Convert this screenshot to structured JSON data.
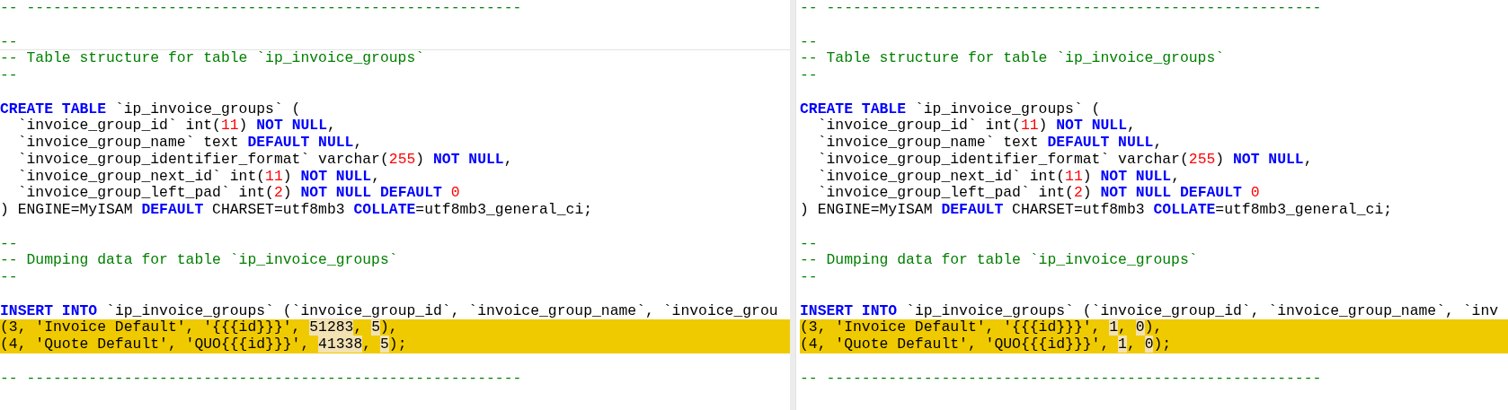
{
  "panes": [
    {
      "lines": [
        {
          "kind": "code",
          "changed": false,
          "tokens": [
            {
              "kind": "comment",
              "text": "-- --------------------------------------------------------"
            }
          ]
        },
        {
          "kind": "blank"
        },
        {
          "kind": "code",
          "changed": false,
          "rule_below": true,
          "tokens": [
            {
              "kind": "comment",
              "text": "--"
            }
          ]
        },
        {
          "kind": "code",
          "changed": false,
          "tokens": [
            {
              "kind": "comment",
              "text": "-- Table structure for table `ip_invoice_groups`"
            }
          ]
        },
        {
          "kind": "code",
          "changed": false,
          "tokens": [
            {
              "kind": "comment",
              "text": "--"
            }
          ]
        },
        {
          "kind": "blank"
        },
        {
          "kind": "code",
          "changed": false,
          "tokens": [
            {
              "kind": "keyword",
              "text": "CREATE TABLE"
            },
            {
              "kind": "plain",
              "text": " `ip_invoice_groups` ("
            }
          ]
        },
        {
          "kind": "code",
          "changed": false,
          "tokens": [
            {
              "kind": "plain",
              "text": "  `invoice_group_id` int("
            },
            {
              "kind": "number",
              "text": "11"
            },
            {
              "kind": "plain",
              "text": ") "
            },
            {
              "kind": "keyword",
              "text": "NOT NULL"
            },
            {
              "kind": "plain",
              "text": ","
            }
          ]
        },
        {
          "kind": "code",
          "changed": false,
          "tokens": [
            {
              "kind": "plain",
              "text": "  `invoice_group_name` text "
            },
            {
              "kind": "keyword",
              "text": "DEFAULT NULL"
            },
            {
              "kind": "plain",
              "text": ","
            }
          ]
        },
        {
          "kind": "code",
          "changed": false,
          "tokens": [
            {
              "kind": "plain",
              "text": "  `invoice_group_identifier_format` varchar("
            },
            {
              "kind": "number",
              "text": "255"
            },
            {
              "kind": "plain",
              "text": ") "
            },
            {
              "kind": "keyword",
              "text": "NOT NULL"
            },
            {
              "kind": "plain",
              "text": ","
            }
          ]
        },
        {
          "kind": "code",
          "changed": false,
          "tokens": [
            {
              "kind": "plain",
              "text": "  `invoice_group_next_id` int("
            },
            {
              "kind": "number",
              "text": "11"
            },
            {
              "kind": "plain",
              "text": ") "
            },
            {
              "kind": "keyword",
              "text": "NOT NULL"
            },
            {
              "kind": "plain",
              "text": ","
            }
          ]
        },
        {
          "kind": "code",
          "changed": false,
          "tokens": [
            {
              "kind": "plain",
              "text": "  `invoice_group_left_pad` int("
            },
            {
              "kind": "number",
              "text": "2"
            },
            {
              "kind": "plain",
              "text": ") "
            },
            {
              "kind": "keyword",
              "text": "NOT NULL DEFAULT "
            },
            {
              "kind": "number",
              "text": "0"
            }
          ]
        },
        {
          "kind": "code",
          "changed": false,
          "tokens": [
            {
              "kind": "plain",
              "text": ") ENGINE=MyISAM "
            },
            {
              "kind": "keyword",
              "text": "DEFAULT"
            },
            {
              "kind": "plain",
              "text": " CHARSET=utf8mb3 "
            },
            {
              "kind": "keyword",
              "text": "COLLATE"
            },
            {
              "kind": "plain",
              "text": "=utf8mb3_general_ci;"
            }
          ]
        },
        {
          "kind": "blank"
        },
        {
          "kind": "code",
          "changed": false,
          "tokens": [
            {
              "kind": "comment",
              "text": "--"
            }
          ]
        },
        {
          "kind": "code",
          "changed": false,
          "tokens": [
            {
              "kind": "comment",
              "text": "-- Dumping data for table `ip_invoice_groups`"
            }
          ]
        },
        {
          "kind": "code",
          "changed": false,
          "tokens": [
            {
              "kind": "comment",
              "text": "--"
            }
          ]
        },
        {
          "kind": "blank"
        },
        {
          "kind": "code",
          "changed": false,
          "tokens": [
            {
              "kind": "keyword",
              "text": "INSERT INTO"
            },
            {
              "kind": "plain",
              "text": " `ip_invoice_groups` (`invoice_group_id`, `invoice_group_name`, `invoice_grou"
            }
          ]
        },
        {
          "kind": "code",
          "changed": true,
          "tokens": [
            {
              "kind": "plain",
              "text": "(3, 'Invoice Default', '{{{id}}}', "
            },
            {
              "kind": "changed",
              "text": "51283"
            },
            {
              "kind": "plain",
              "text": ", "
            },
            {
              "kind": "changed",
              "text": "5"
            },
            {
              "kind": "plain",
              "text": "),"
            }
          ]
        },
        {
          "kind": "code",
          "changed": true,
          "tokens": [
            {
              "kind": "plain",
              "text": "(4, 'Quote Default', 'QUO{{{id}}}', "
            },
            {
              "kind": "changed",
              "text": "41338"
            },
            {
              "kind": "plain",
              "text": ", "
            },
            {
              "kind": "changed",
              "text": "5"
            },
            {
              "kind": "plain",
              "text": ");"
            }
          ]
        },
        {
          "kind": "blank"
        },
        {
          "kind": "code",
          "changed": false,
          "tokens": [
            {
              "kind": "comment",
              "text": "-- --------------------------------------------------------"
            }
          ]
        }
      ]
    },
    {
      "lines": [
        {
          "kind": "code",
          "changed": false,
          "tokens": [
            {
              "kind": "comment",
              "text": "-- --------------------------------------------------------"
            }
          ]
        },
        {
          "kind": "blank"
        },
        {
          "kind": "code",
          "changed": false,
          "tokens": [
            {
              "kind": "comment",
              "text": "--"
            }
          ]
        },
        {
          "kind": "code",
          "changed": false,
          "tokens": [
            {
              "kind": "comment",
              "text": "-- Table structure for table `ip_invoice_groups`"
            }
          ]
        },
        {
          "kind": "code",
          "changed": false,
          "tokens": [
            {
              "kind": "comment",
              "text": "--"
            }
          ]
        },
        {
          "kind": "blank"
        },
        {
          "kind": "code",
          "changed": false,
          "tokens": [
            {
              "kind": "keyword",
              "text": "CREATE TABLE"
            },
            {
              "kind": "plain",
              "text": " `ip_invoice_groups` ("
            }
          ]
        },
        {
          "kind": "code",
          "changed": false,
          "tokens": [
            {
              "kind": "plain",
              "text": "  `invoice_group_id` int("
            },
            {
              "kind": "number",
              "text": "11"
            },
            {
              "kind": "plain",
              "text": ") "
            },
            {
              "kind": "keyword",
              "text": "NOT NULL"
            },
            {
              "kind": "plain",
              "text": ","
            }
          ]
        },
        {
          "kind": "code",
          "changed": false,
          "tokens": [
            {
              "kind": "plain",
              "text": "  `invoice_group_name` text "
            },
            {
              "kind": "keyword",
              "text": "DEFAULT NULL"
            },
            {
              "kind": "plain",
              "text": ","
            }
          ]
        },
        {
          "kind": "code",
          "changed": false,
          "tokens": [
            {
              "kind": "plain",
              "text": "  `invoice_group_identifier_format` varchar("
            },
            {
              "kind": "number",
              "text": "255"
            },
            {
              "kind": "plain",
              "text": ") "
            },
            {
              "kind": "keyword",
              "text": "NOT NULL"
            },
            {
              "kind": "plain",
              "text": ","
            }
          ]
        },
        {
          "kind": "code",
          "changed": false,
          "tokens": [
            {
              "kind": "plain",
              "text": "  `invoice_group_next_id` int("
            },
            {
              "kind": "number",
              "text": "11"
            },
            {
              "kind": "plain",
              "text": ") "
            },
            {
              "kind": "keyword",
              "text": "NOT NULL"
            },
            {
              "kind": "plain",
              "text": ","
            }
          ]
        },
        {
          "kind": "code",
          "changed": false,
          "tokens": [
            {
              "kind": "plain",
              "text": "  `invoice_group_left_pad` int("
            },
            {
              "kind": "number",
              "text": "2"
            },
            {
              "kind": "plain",
              "text": ") "
            },
            {
              "kind": "keyword",
              "text": "NOT NULL DEFAULT "
            },
            {
              "kind": "number",
              "text": "0"
            }
          ]
        },
        {
          "kind": "code",
          "changed": false,
          "tokens": [
            {
              "kind": "plain",
              "text": ") ENGINE=MyISAM "
            },
            {
              "kind": "keyword",
              "text": "DEFAULT"
            },
            {
              "kind": "plain",
              "text": " CHARSET=utf8mb3 "
            },
            {
              "kind": "keyword",
              "text": "COLLATE"
            },
            {
              "kind": "plain",
              "text": "=utf8mb3_general_ci;"
            }
          ]
        },
        {
          "kind": "blank"
        },
        {
          "kind": "code",
          "changed": false,
          "tokens": [
            {
              "kind": "comment",
              "text": "--"
            }
          ]
        },
        {
          "kind": "code",
          "changed": false,
          "tokens": [
            {
              "kind": "comment",
              "text": "-- Dumping data for table `ip_invoice_groups`"
            }
          ]
        },
        {
          "kind": "code",
          "changed": false,
          "tokens": [
            {
              "kind": "comment",
              "text": "--"
            }
          ]
        },
        {
          "kind": "blank"
        },
        {
          "kind": "code",
          "changed": false,
          "tokens": [
            {
              "kind": "keyword",
              "text": "INSERT INTO"
            },
            {
              "kind": "plain",
              "text": " `ip_invoice_groups` (`invoice_group_id`, `invoice_group_name`, `inv"
            }
          ]
        },
        {
          "kind": "code",
          "changed": true,
          "tokens": [
            {
              "kind": "plain",
              "text": "(3, 'Invoice Default', '{{{id}}}', "
            },
            {
              "kind": "changed",
              "text": "1"
            },
            {
              "kind": "plain",
              "text": ", "
            },
            {
              "kind": "changed",
              "text": "0"
            },
            {
              "kind": "plain",
              "text": "),"
            }
          ]
        },
        {
          "kind": "code",
          "changed": true,
          "tokens": [
            {
              "kind": "plain",
              "text": "(4, 'Quote Default', 'QUO{{{id}}}', "
            },
            {
              "kind": "changed",
              "text": "1"
            },
            {
              "kind": "plain",
              "text": ", "
            },
            {
              "kind": "changed",
              "text": "0"
            },
            {
              "kind": "plain",
              "text": ");"
            }
          ]
        },
        {
          "kind": "blank"
        },
        {
          "kind": "code",
          "changed": false,
          "tokens": [
            {
              "kind": "comment",
              "text": "-- --------------------------------------------------------"
            }
          ]
        }
      ]
    }
  ]
}
